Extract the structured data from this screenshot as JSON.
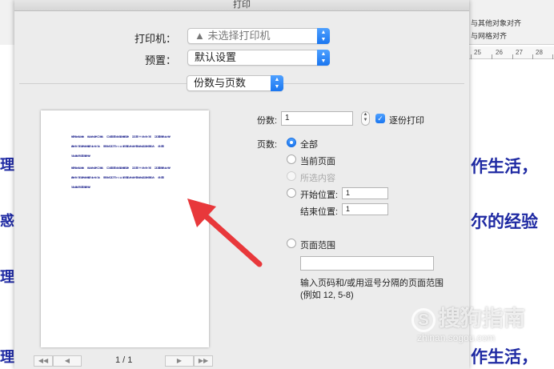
{
  "dialog": {
    "title": "打印",
    "printer_label": "打印机：",
    "printer_value": "▲ 未选择打印机",
    "preset_label": "预置：",
    "preset_value": "默认设置",
    "section_value": "份数与页数"
  },
  "copies": {
    "label": "份数:",
    "value": "1",
    "collate_label": "逐份打印",
    "collate_checked": true
  },
  "pages": {
    "label": "页数:",
    "options": [
      {
        "label": "全部",
        "selected": true,
        "enabled": true
      },
      {
        "label": "当前页面",
        "selected": false,
        "enabled": true
      },
      {
        "label": "所选内容",
        "selected": false,
        "enabled": false
      },
      {
        "label": "开始位置:",
        "selected": false,
        "enabled": true
      }
    ],
    "from_value": "1",
    "to_label": "结束位置:",
    "to_value": "1",
    "range_label": "页面范围",
    "range_value": "",
    "range_help": "输入页码和/或用逗号分隔的页面范围(例如 12, 5-8)"
  },
  "preview": {
    "lines": [
      "搜狗指南，指的就只能，只得是电脑搬砖，还是工作生活，还需要去学",
      "做生活就的解决方法，同时还可以从前事会的我的经验理论，总是",
      "该使用是要学",
      "搜狗指南，指的就只能，只得是电脑搬砖，还是工作生活，还需要去学",
      "做生活就的解决方法，同时还可以从前事会的我的经验理论，总是",
      "该使用是要学"
    ],
    "page_indicator": "1 / 1",
    "first_icon": "◀◀",
    "prev_icon": "◀",
    "next_icon": "▶",
    "last_icon": "▶▶"
  },
  "background_app": {
    "toolbar_item_1": "与其他对象对齐",
    "toolbar_item_2": "与网格对齐",
    "ruler_labels": [
      "25",
      "26",
      "27",
      "28"
    ],
    "doc_line_1": "作生活，",
    "doc_line_2": "尔的经验",
    "doc_line_3": "作生活，",
    "left_chars": [
      "理",
      "惑",
      "理",
      "理"
    ]
  },
  "watermark": {
    "logo_char": "S",
    "text": "搜狗指南",
    "url": "zhinan.sogou.com"
  },
  "colors": {
    "accent": "#1a76f0",
    "doc_text": "#1f2aa3",
    "arrow": "#e8383b"
  }
}
